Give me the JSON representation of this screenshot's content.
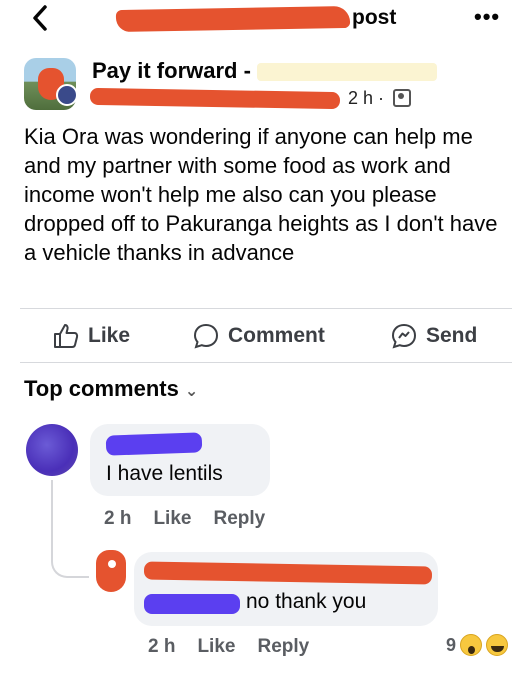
{
  "header": {
    "title_suffix": "post",
    "more_icon": "more-dots-icon",
    "back_icon": "chevron-left-icon"
  },
  "post": {
    "group_name": "Pay it forward -",
    "time": "2 h",
    "separator": "·",
    "privacy_icon": "group-privacy-icon",
    "text": "Kia Ora was wondering if anyone can help me and my partner with some food as work and income won't help me also can you please dropped off to Pakuranga heights as I don't have a vehicle thanks in advance"
  },
  "actions": {
    "like": "Like",
    "comment": "Comment",
    "send": "Send"
  },
  "comments_section": {
    "heading": "Top comments",
    "comments": [
      {
        "text": "I have lentils",
        "time": "2 h",
        "like": "Like",
        "reply": "Reply"
      },
      {
        "text": "no thank you",
        "time": "2 h",
        "like": "Like",
        "reply": "Reply",
        "reaction_count": "9",
        "reactions": [
          "wow-emoji-icon",
          "haha-emoji-icon"
        ]
      }
    ]
  },
  "colors": {
    "redaction_red": "#e5532f",
    "redaction_purple": "#5b3ff0",
    "bubble_bg": "#f0f2f5",
    "muted_text": "#5a5d62"
  }
}
